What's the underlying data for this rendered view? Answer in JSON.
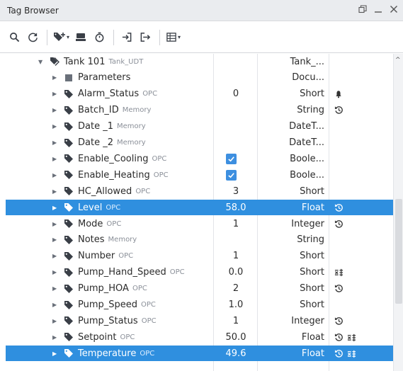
{
  "window": {
    "title": "Tag Browser",
    "restore_icon": "restore-icon",
    "minimize_icon": "minimize-icon",
    "close_icon": "close-icon"
  },
  "toolbar": {
    "buttons": [
      "search-icon",
      "refresh-icon",
      "add-tag-icon",
      "database-icon",
      "clock-icon",
      "import-icon",
      "export-icon",
      "table-view-icon"
    ]
  },
  "colors": {
    "selection": "#2f8fdf",
    "checkbox": "#3d8fe0",
    "title_bar": "#eaecef"
  },
  "rows": [
    {
      "name": "Tank 101",
      "source": "Tank_UDT",
      "value": "",
      "type": "Tank_...",
      "flags": [],
      "icon": "udt-instance-icon",
      "level": 0,
      "expanded": true,
      "selected": false,
      "checkbox": false
    },
    {
      "name": "Parameters",
      "source": "",
      "value": "",
      "type": "Docu...",
      "flags": [],
      "icon": "parameters-icon",
      "level": 1,
      "expanded": false,
      "selected": false,
      "checkbox": false
    },
    {
      "name": "Alarm_Status",
      "source": "OPC",
      "value": "0",
      "type": "Short",
      "flags": [
        "alarm-bell-icon"
      ],
      "icon": "tag-icon",
      "level": 1,
      "expanded": false,
      "selected": false,
      "checkbox": false
    },
    {
      "name": "Batch_ID",
      "source": "Memory",
      "value": "",
      "type": "String",
      "flags": [
        "history-icon"
      ],
      "icon": "tag-icon",
      "level": 1,
      "expanded": false,
      "selected": false,
      "checkbox": false
    },
    {
      "name": "Date _1",
      "source": "Memory",
      "value": "",
      "type": "DateT...",
      "flags": [],
      "icon": "tag-icon",
      "level": 1,
      "expanded": false,
      "selected": false,
      "checkbox": false
    },
    {
      "name": "Date _2",
      "source": "Memory",
      "value": "",
      "type": "DateT...",
      "flags": [],
      "icon": "tag-icon",
      "level": 1,
      "expanded": false,
      "selected": false,
      "checkbox": false
    },
    {
      "name": "Enable_Cooling",
      "source": "OPC",
      "value": "",
      "type": "Boole...",
      "flags": [],
      "icon": "tag-icon",
      "level": 1,
      "expanded": false,
      "selected": false,
      "checkbox": true
    },
    {
      "name": "Enable_Heating",
      "source": "OPC",
      "value": "",
      "type": "Boole...",
      "flags": [],
      "icon": "tag-icon",
      "level": 1,
      "expanded": false,
      "selected": false,
      "checkbox": true
    },
    {
      "name": "HC_Allowed",
      "source": "OPC",
      "value": "3",
      "type": "Short",
      "flags": [],
      "icon": "tag-icon",
      "level": 1,
      "expanded": false,
      "selected": false,
      "checkbox": false
    },
    {
      "name": "Level",
      "source": "OPC",
      "value": "58.0",
      "type": "Float",
      "flags": [
        "history-icon"
      ],
      "icon": "tag-icon",
      "level": 1,
      "expanded": false,
      "selected": true,
      "checkbox": false
    },
    {
      "name": "Mode",
      "source": "OPC",
      "value": "1",
      "type": "Integer",
      "flags": [
        "history-icon"
      ],
      "icon": "tag-icon",
      "level": 1,
      "expanded": false,
      "selected": false,
      "checkbox": false
    },
    {
      "name": "Notes",
      "source": "Memory",
      "value": "",
      "type": "String",
      "flags": [],
      "icon": "tag-icon",
      "level": 1,
      "expanded": false,
      "selected": false,
      "checkbox": false
    },
    {
      "name": "Number",
      "source": "OPC",
      "value": "1",
      "type": "Short",
      "flags": [],
      "icon": "tag-icon",
      "level": 1,
      "expanded": false,
      "selected": false,
      "checkbox": false
    },
    {
      "name": "Pump_Hand_Speed",
      "source": "OPC",
      "value": "0.0",
      "type": "Short",
      "flags": [
        "scaling-icon"
      ],
      "icon": "tag-icon",
      "level": 1,
      "expanded": false,
      "selected": false,
      "checkbox": false
    },
    {
      "name": "Pump_HOA",
      "source": "OPC",
      "value": "2",
      "type": "Short",
      "flags": [
        "history-icon"
      ],
      "icon": "tag-icon",
      "level": 1,
      "expanded": false,
      "selected": false,
      "checkbox": false
    },
    {
      "name": "Pump_Speed",
      "source": "OPC",
      "value": "1.0",
      "type": "Short",
      "flags": [],
      "icon": "tag-icon",
      "level": 1,
      "expanded": false,
      "selected": false,
      "checkbox": false
    },
    {
      "name": "Pump_Status",
      "source": "OPC",
      "value": "1",
      "type": "Integer",
      "flags": [
        "history-icon"
      ],
      "icon": "tag-icon",
      "level": 1,
      "expanded": false,
      "selected": false,
      "checkbox": false
    },
    {
      "name": "Setpoint",
      "source": "OPC",
      "value": "50.0",
      "type": "Float",
      "flags": [
        "history-icon",
        "scaling-icon"
      ],
      "icon": "tag-icon",
      "level": 1,
      "expanded": false,
      "selected": false,
      "checkbox": false
    },
    {
      "name": "Temperature",
      "source": "OPC",
      "value": "49.6",
      "type": "Float",
      "flags": [
        "history-icon",
        "scaling-icon"
      ],
      "icon": "tag-icon",
      "level": 1,
      "expanded": false,
      "selected": true,
      "checkbox": false
    }
  ]
}
